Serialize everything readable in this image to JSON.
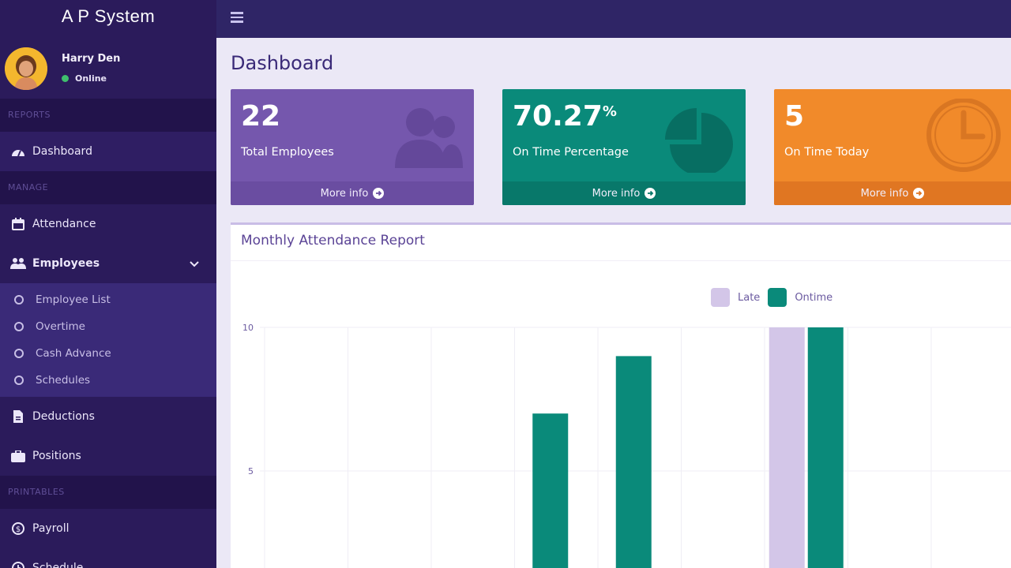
{
  "app": {
    "title": "A P System"
  },
  "user": {
    "name": "Harry Den",
    "status": "Online"
  },
  "sidebar": {
    "sections": {
      "reports": "REPORTS",
      "manage": "MANAGE",
      "printables": "PRINTABLES"
    },
    "items": {
      "dashboard": "Dashboard",
      "attendance": "Attendance",
      "employees": "Employees",
      "deductions": "Deductions",
      "positions": "Positions",
      "payroll": "Payroll",
      "schedule": "Schedule"
    },
    "employees_sub": [
      "Employee List",
      "Overtime",
      "Cash Advance",
      "Schedules"
    ]
  },
  "page": {
    "title": "Dashboard"
  },
  "boxes": {
    "total_employees": {
      "value": "22",
      "label": "Total Employees",
      "more": "More info"
    },
    "on_time_pct": {
      "value": "70.27",
      "suffix": "%",
      "label": "On Time Percentage",
      "more": "More info"
    },
    "on_time_today": {
      "value": "5",
      "label": "On Time Today",
      "more": "More info"
    }
  },
  "colors": {
    "purple": "#7557ad",
    "teal": "#0a8a7a",
    "orange": "#f18a2a",
    "late": "#d3c6e8",
    "ontime": "#0a8a7a"
  },
  "report": {
    "title": "Monthly Attendance Report"
  },
  "chart_data": {
    "type": "bar",
    "title": "",
    "xlabel": "",
    "ylabel": "",
    "ylim": [
      0,
      10
    ],
    "yticks": [
      5,
      10
    ],
    "grid": true,
    "legend": "top-center",
    "categories_count_visible": 9,
    "series": [
      {
        "name": "Late",
        "color": "#d3c6e8",
        "values": [
          0,
          0,
          0,
          0,
          0,
          0,
          10,
          0,
          0
        ]
      },
      {
        "name": "Ontime",
        "color": "#0a8a7a",
        "values": [
          0,
          0,
          0,
          7,
          9,
          0,
          10,
          0,
          0
        ]
      }
    ]
  }
}
